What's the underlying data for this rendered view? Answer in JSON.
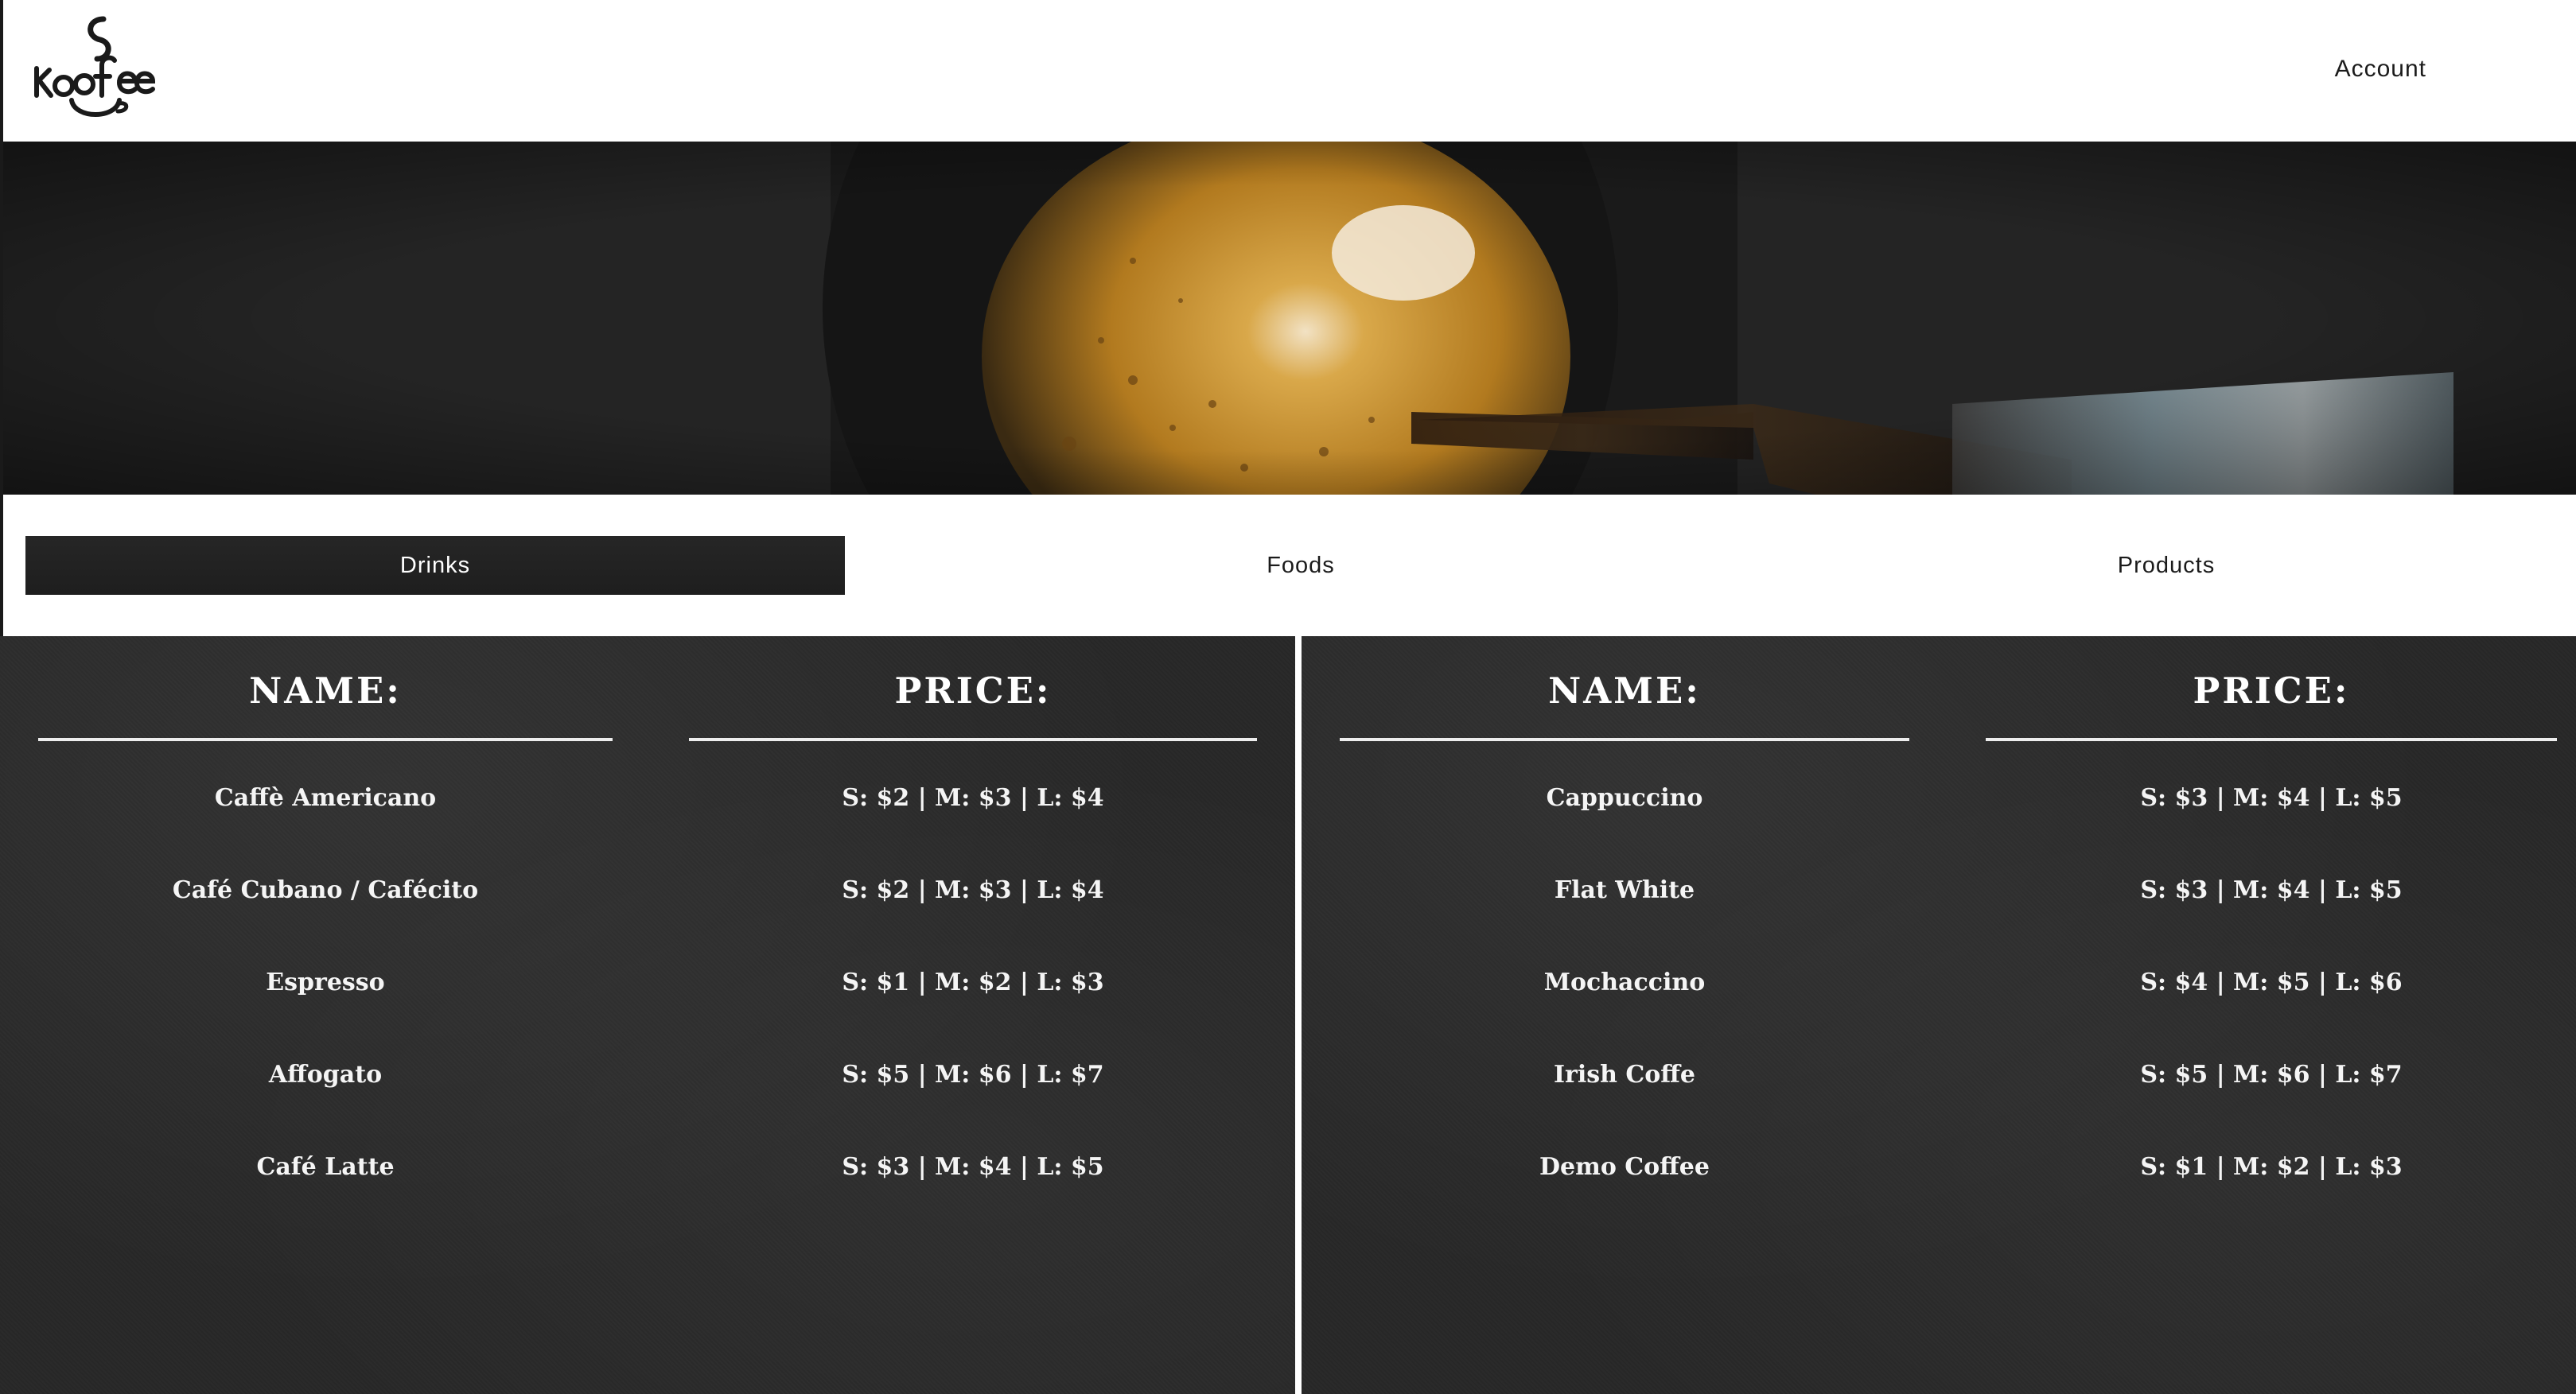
{
  "header": {
    "logo_text": "koffee",
    "account_label": "Account"
  },
  "hero": {
    "image_description_icon": "espresso-shot-banner"
  },
  "tabs": [
    {
      "label": "Drinks",
      "active": true
    },
    {
      "label": "Foods",
      "active": false
    },
    {
      "label": "Products",
      "active": false
    }
  ],
  "menu": {
    "left": {
      "name_header": "NAME:",
      "price_header": "PRICE:",
      "items": [
        {
          "name": "Caffè Americano",
          "price": "S: $2 | M: $3 | L: $4"
        },
        {
          "name": "Café Cubano / Cafécito",
          "price": "S: $2 | M: $3 | L: $4"
        },
        {
          "name": "Espresso",
          "price": "S: $1 | M: $2 | L: $3"
        },
        {
          "name": "Affogato",
          "price": "S: $5 | M: $6 | L: $7"
        },
        {
          "name": "Café Latte",
          "price": "S: $3 | M: $4 | L: $5"
        }
      ]
    },
    "right": {
      "name_header": "NAME:",
      "price_header": "PRICE:",
      "items": [
        {
          "name": "Cappuccino",
          "price": "S: $3 | M: $4 | L: $5"
        },
        {
          "name": "Flat White",
          "price": "S: $3 | M: $4 | L: $5"
        },
        {
          "name": "Mochaccino",
          "price": "S: $4 | M: $5 | L: $6"
        },
        {
          "name": "Irish Coffe",
          "price": "S: $5 | M: $6 | L: $7"
        },
        {
          "name": "Demo Coffee",
          "price": "S: $1 | M: $2 | L: $3"
        }
      ]
    }
  },
  "colors": {
    "board": "#282828",
    "tab_active": "#222222",
    "crema": "#c9952e"
  }
}
